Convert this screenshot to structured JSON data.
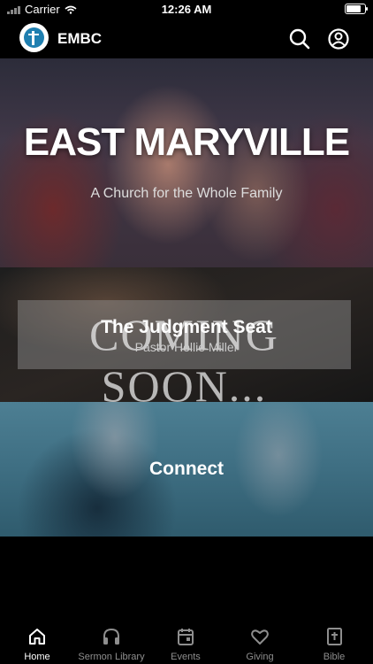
{
  "status_bar": {
    "carrier": "Carrier",
    "time": "12:26 AM",
    "battery_level": 0.9
  },
  "header": {
    "app_name": "EMBC",
    "icons": [
      "search-icon",
      "account-icon"
    ]
  },
  "hero": {
    "title": "EAST MARYVILLE",
    "subtitle": "A Church for the Whole Family"
  },
  "sermon": {
    "banner_text": "COMING SOON...",
    "title": "The Judgment Seat",
    "speaker": "Pastor Hollie Miller"
  },
  "connect": {
    "title": "Connect"
  },
  "tabs": [
    {
      "label": "Home",
      "icon": "home-icon",
      "active": true
    },
    {
      "label": "Sermon Library",
      "icon": "headphones-icon",
      "active": false
    },
    {
      "label": "Events",
      "icon": "calendar-icon",
      "active": false
    },
    {
      "label": "Giving",
      "icon": "heart-icon",
      "active": false
    },
    {
      "label": "Bible",
      "icon": "bible-icon",
      "active": false
    }
  ],
  "colors": {
    "background": "#000000",
    "tab_active": "#ffffff",
    "tab_inactive": "#8e8e8e",
    "logo_blue": "#1f7fb0"
  }
}
